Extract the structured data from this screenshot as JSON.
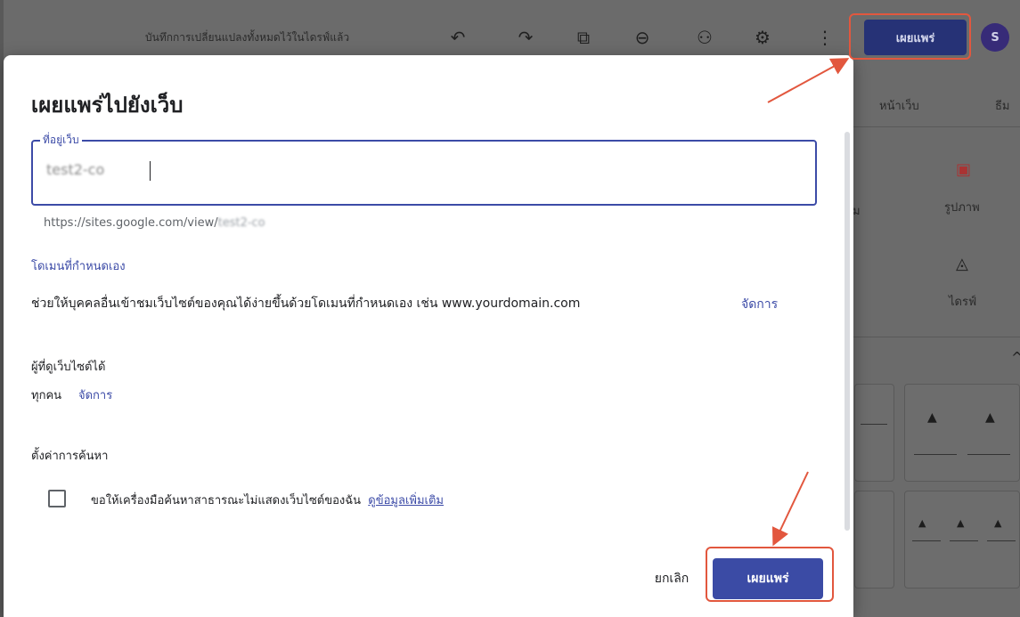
{
  "toolbar": {
    "saved_status": "บันทึกการเปลี่ยนแปลงทั้งหมดไว้ในไดรฟ์แล้ว",
    "undo_glyph": "↶",
    "redo_glyph": "↷",
    "preview_glyph": "⧉",
    "link_glyph": "⊖",
    "share_glyph": "⚇",
    "settings_glyph": "⚙",
    "more_glyph": "⋮",
    "publish_label": "เผยแพร่",
    "avatar_initial": "S"
  },
  "side_panel": {
    "tabs": [
      "หน้าเว็บ",
      "ธีม"
    ],
    "partial_label": "ม",
    "insert_items": [
      {
        "label": "รูปภาพ",
        "icon": "image-icon",
        "glyph": "▣"
      },
      {
        "label": "ไดรฟ์",
        "icon": "drive-icon",
        "glyph": "◬"
      }
    ],
    "collapse_glyph": "^",
    "tile_glyph": "▲"
  },
  "dialog": {
    "title": "เผยแพร่ไปยังเว็บ",
    "address_label": "ที่อยู่เว็บ",
    "address_value": "test2-co",
    "url_prefix": "https://sites.google.com/view/",
    "url_suffix": "test2-co",
    "custom_domain_label": "โดเมนที่กำหนดเอง",
    "custom_domain_text": "ช่วยให้บุคคลอื่นเข้าชมเว็บไซต์ของคุณได้ง่ายขึ้นด้วยโดเมนที่กำหนดเอง เช่น www.yourdomain.com",
    "manage_label": "จัดการ",
    "viewers_label": "ผู้ที่ดูเว็บไซต์ได้",
    "viewers_value": "ทุกคน",
    "viewers_manage_label": "จัดการ",
    "search_settings_label": "ตั้งค่าการค้นหา",
    "search_checkbox_label": "ขอให้เครื่องมือค้นหาสาธารณะไม่แสดงเว็บไซต์ของฉัน",
    "learn_more_label": "ดูข้อมูลเพิ่มเติม",
    "cancel_label": "ยกเลิก",
    "publish_label": "เผยแพร่"
  },
  "colors": {
    "accent": "#3b4ba5",
    "highlight": "#e2573e"
  }
}
